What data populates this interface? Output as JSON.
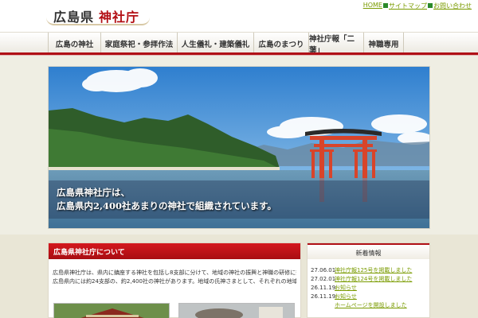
{
  "header": {
    "logo_pref": "広島県",
    "logo_org": "神社庁",
    "top_links": [
      "HOME",
      "サイトマップ",
      "お問い合わせ"
    ]
  },
  "nav": {
    "items": [
      {
        "label": "広島の神社"
      },
      {
        "label": "家庭祭祀・参拝作法"
      },
      {
        "label": "人生儀礼・建築儀礼"
      },
      {
        "label": "広島のまつり"
      },
      {
        "label": "神社庁報「二葉」"
      },
      {
        "label": "神職専用"
      }
    ]
  },
  "hero": {
    "line1": "広島県神社庁は、",
    "line2": "広島県内2,400社あまりの神社で組織されています。"
  },
  "main": {
    "heading": "広島県神社庁について",
    "line1": "広島県神社庁は、県内に鎮座する神社を包括し8支部に分けて、地域の神社の振興と神職の研修に努めております。",
    "line2": "広島県内には約24支部の、約2,400社の神社があります。地域の氏神さまとして、それぞれの地域の人々に親しまれ、崇敬されています。"
  },
  "news": {
    "heading": "新着情報",
    "items": [
      {
        "date": "27.06.01",
        "title": "神社庁報125号を掲載しました"
      },
      {
        "date": "27.02.01",
        "title": "神社庁報124号を掲載しました"
      },
      {
        "date": "26.11.19",
        "title": "お知らせ"
      },
      {
        "date": "26.11.19",
        "title": "お知らせ"
      },
      {
        "date": "",
        "title": "ホームページを開設しました"
      }
    ]
  },
  "colors": {
    "accent_red": "#b01016",
    "link_green": "#7a9b00"
  }
}
